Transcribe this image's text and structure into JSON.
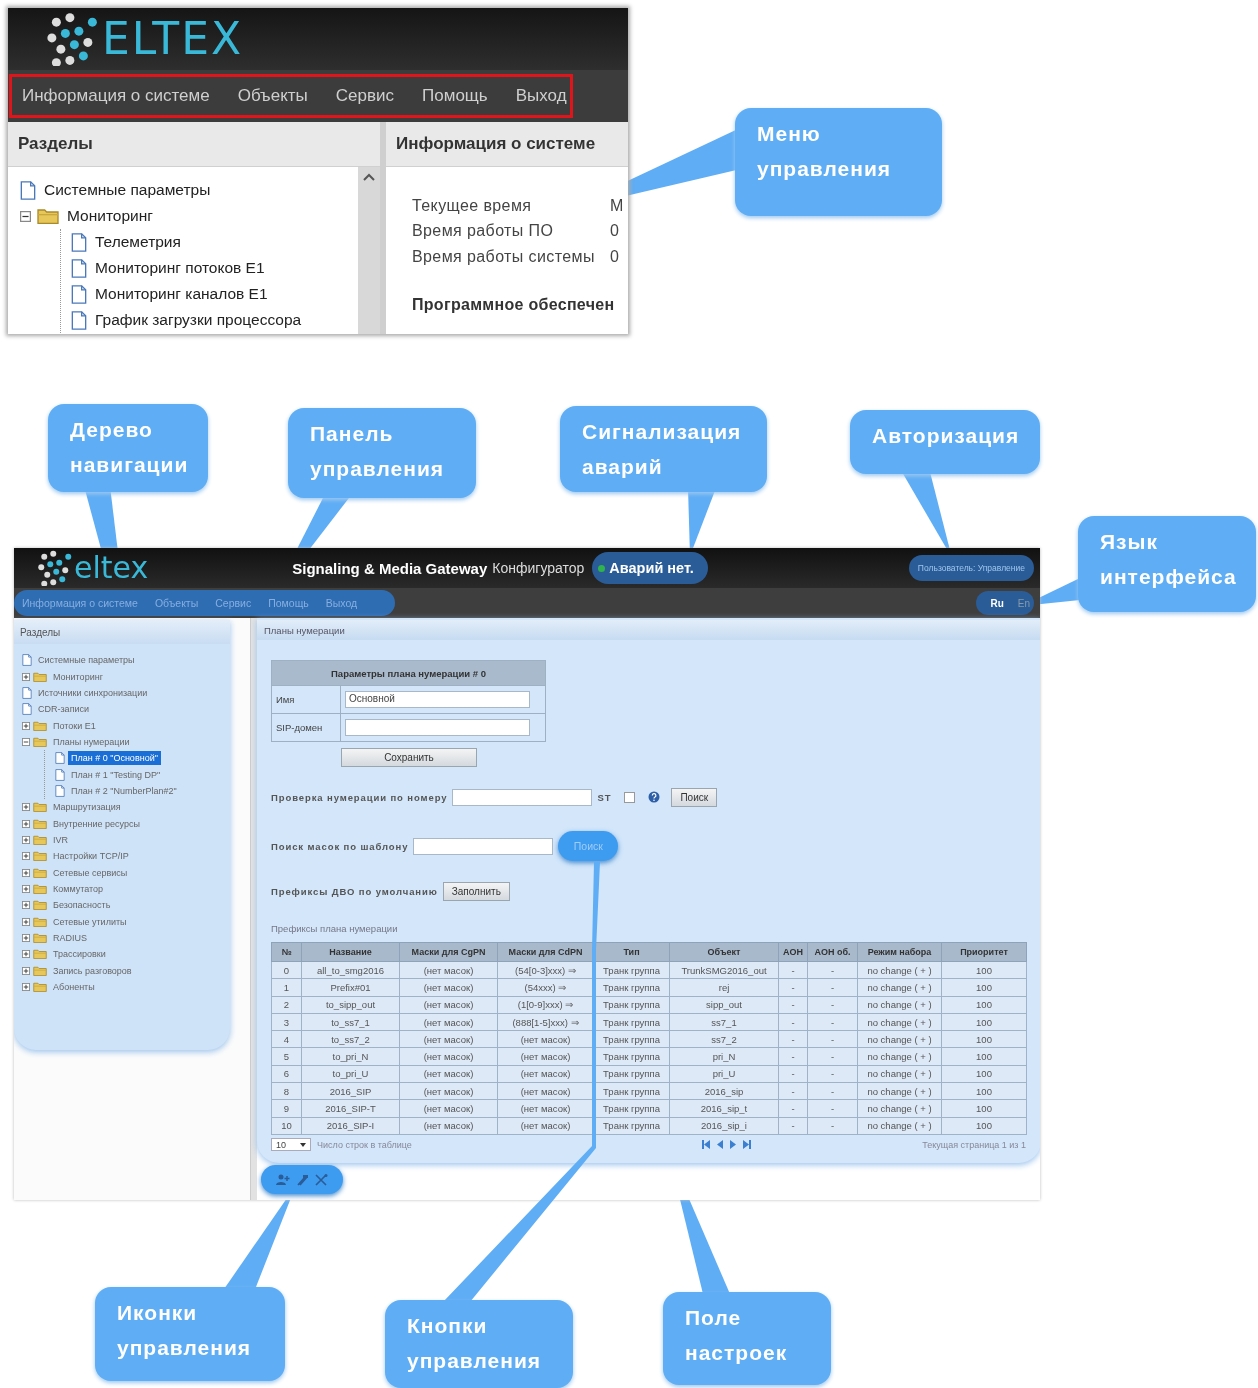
{
  "top_screen": {
    "logo": "ELTEX",
    "menu": [
      "Информация о системе",
      "Объекты",
      "Сервис",
      "Помощь",
      "Выход"
    ],
    "sections_title": "Разделы",
    "tree": [
      {
        "label": "Системные параметры",
        "kind": "file",
        "selected": false
      },
      {
        "label": "Мониторинг",
        "kind": "folder",
        "expanded": true,
        "selected": false,
        "children": [
          {
            "label": "Телеметрия",
            "kind": "file",
            "selected": false
          },
          {
            "label": "Мониторинг потоков E1",
            "kind": "file",
            "selected": false
          },
          {
            "label": "Мониторинг каналов E1",
            "kind": "file",
            "selected": false
          },
          {
            "label": "График загрузки процессора",
            "kind": "file",
            "selected": false
          }
        ]
      }
    ],
    "info_title": "Информация о системе",
    "info_rows": [
      {
        "label": "Текущее время",
        "value": "М"
      },
      {
        "label": "Время работы ПО",
        "value": "0"
      },
      {
        "label": "Время работы системы",
        "value": "0"
      }
    ],
    "info_heading": "Программное обеспечен"
  },
  "main_screen": {
    "logo": "eltex",
    "product": "Signaling & Media Gateway",
    "product_suffix": "Конфигуратор",
    "alarm": "Аварий нет.",
    "user": "Пользователь: Управление",
    "menu": [
      "Информация о системе",
      "Объекты",
      "Сервис",
      "Помощь",
      "Выход"
    ],
    "languages": [
      {
        "label": "Ru",
        "selected": true
      },
      {
        "label": "En",
        "selected": false
      }
    ],
    "sections_title": "Разделы",
    "tree": [
      {
        "label": "Системные параметры",
        "kind": "file",
        "selected": false
      },
      {
        "label": "Мониторинг",
        "kind": "folder",
        "expanded": false,
        "selected": false
      },
      {
        "label": "Источники синхронизации",
        "kind": "file",
        "selected": false
      },
      {
        "label": "CDR-записи",
        "kind": "file",
        "selected": false
      },
      {
        "label": "Потоки E1",
        "kind": "folder",
        "expanded": false,
        "selected": false
      },
      {
        "label": "Планы нумерации",
        "kind": "folder",
        "expanded": true,
        "selected": false,
        "children": [
          {
            "label": "План # 0 \"Основной\"",
            "kind": "file",
            "selected": true
          },
          {
            "label": "План # 1 \"Testing DP\"",
            "kind": "file",
            "selected": false
          },
          {
            "label": "План # 2 \"NumberPlan#2\"",
            "kind": "file",
            "selected": false
          }
        ]
      },
      {
        "label": "Маршрутизация",
        "kind": "folder",
        "expanded": false,
        "selected": false
      },
      {
        "label": "Внутренние ресурсы",
        "kind": "folder",
        "expanded": false,
        "selected": false
      },
      {
        "label": "IVR",
        "kind": "folder",
        "expanded": false,
        "selected": false
      },
      {
        "label": "Настройки TCP/IP",
        "kind": "folder",
        "expanded": false,
        "selected": false
      },
      {
        "label": "Сетевые сервисы",
        "kind": "folder",
        "expanded": false,
        "selected": false
      },
      {
        "label": "Коммутатор",
        "kind": "folder",
        "expanded": false,
        "selected": false
      },
      {
        "label": "Безопасность",
        "kind": "folder",
        "expanded": false,
        "selected": false
      },
      {
        "label": "Сетевые утилиты",
        "kind": "folder",
        "expanded": false,
        "selected": false
      },
      {
        "label": "RADIUS",
        "kind": "folder",
        "expanded": false,
        "selected": false
      },
      {
        "label": "Трассировки",
        "kind": "folder",
        "expanded": false,
        "selected": false
      },
      {
        "label": "Запись разговоров",
        "kind": "folder",
        "expanded": false,
        "selected": false
      },
      {
        "label": "Абоненты",
        "kind": "folder",
        "expanded": false,
        "selected": false
      }
    ],
    "page_title": "Планы нумерации",
    "form": {
      "title": "Параметры плана нумерации # 0",
      "fields": [
        {
          "label": "Имя",
          "value": "Основной"
        },
        {
          "label": "SIP-домен"
        }
      ],
      "save_button": "Сохранить"
    },
    "number_check": {
      "label": "Проверка нумерации по номеру",
      "st_label": "ST",
      "st_checked": false,
      "button": "Поиск"
    },
    "mask_search": {
      "label": "Поиск масок по шаблону",
      "button": "Поиск"
    },
    "prefixes": {
      "label": "Префиксы ДВО по умолчанию",
      "button": "Заполнить"
    },
    "table_title": "Префиксы плана нумерации",
    "table": {
      "columns": [
        "№",
        "Название",
        "Маски для CgPN",
        "Маски для CdPN",
        "Тип",
        "Объект",
        "АОН",
        "АОН об.",
        "Режим набора",
        "Приоритет"
      ],
      "rows": [
        [
          "0",
          "all_to_smg2016",
          "(нет масок)",
          "(54[0-3]xxx) ⇒",
          "Транк группа",
          "TrunkSMG2016_out",
          "-",
          "-",
          "no change ( + )",
          "100"
        ],
        [
          "1",
          "Prefix#01",
          "(нет масок)",
          "(54xxx) ⇒",
          "Транк группа",
          "rej",
          "-",
          "-",
          "no change ( + )",
          "100"
        ],
        [
          "2",
          "to_sipp_out",
          "(нет масок)",
          "(1[0-9]xxx) ⇒",
          "Транк группа",
          "sipp_out",
          "-",
          "-",
          "no change ( + )",
          "100"
        ],
        [
          "3",
          "to_ss7_1",
          "(нет масок)",
          "(888[1-5]xxx) ⇒",
          "Транк группа",
          "ss7_1",
          "-",
          "-",
          "no change ( + )",
          "100"
        ],
        [
          "4",
          "to_ss7_2",
          "(нет масок)",
          "(нет масок)",
          "Транк группа",
          "ss7_2",
          "-",
          "-",
          "no change ( + )",
          "100"
        ],
        [
          "5",
          "to_pri_N",
          "(нет масок)",
          "(нет масок)",
          "Транк группа",
          "pri_N",
          "-",
          "-",
          "no change ( + )",
          "100"
        ],
        [
          "6",
          "to_pri_U",
          "(нет масок)",
          "(нет масок)",
          "Транк группа",
          "pri_U",
          "-",
          "-",
          "no change ( + )",
          "100"
        ],
        [
          "8",
          "2016_SIP",
          "(нет масок)",
          "(нет масок)",
          "Транк группа",
          "2016_sip",
          "-",
          "-",
          "no change ( + )",
          "100"
        ],
        [
          "9",
          "2016_SIP-T",
          "(нет масок)",
          "(нет масок)",
          "Транк группа",
          "2016_sip_t",
          "-",
          "-",
          "no change ( + )",
          "100"
        ],
        [
          "10",
          "2016_SIP-I",
          "(нет масок)",
          "(нет масок)",
          "Транк группа",
          "2016_sip_i",
          "-",
          "-",
          "no change ( + )",
          "100"
        ]
      ]
    },
    "page_size": "10",
    "page_size_label": "Число строк в таблице",
    "page_info": "Текущая страница 1 из 1"
  },
  "callouts": [
    {
      "text": "Меню управления"
    },
    {
      "text": "Дерево навигации"
    },
    {
      "text": "Панель управления"
    },
    {
      "text": "Сигнализация аварий"
    },
    {
      "text": "Авторизация"
    },
    {
      "text": "Язык интерфейса"
    },
    {
      "text": "Иконки управления"
    },
    {
      "text": "Кнопки управления"
    },
    {
      "text": "Поле настроек"
    }
  ]
}
